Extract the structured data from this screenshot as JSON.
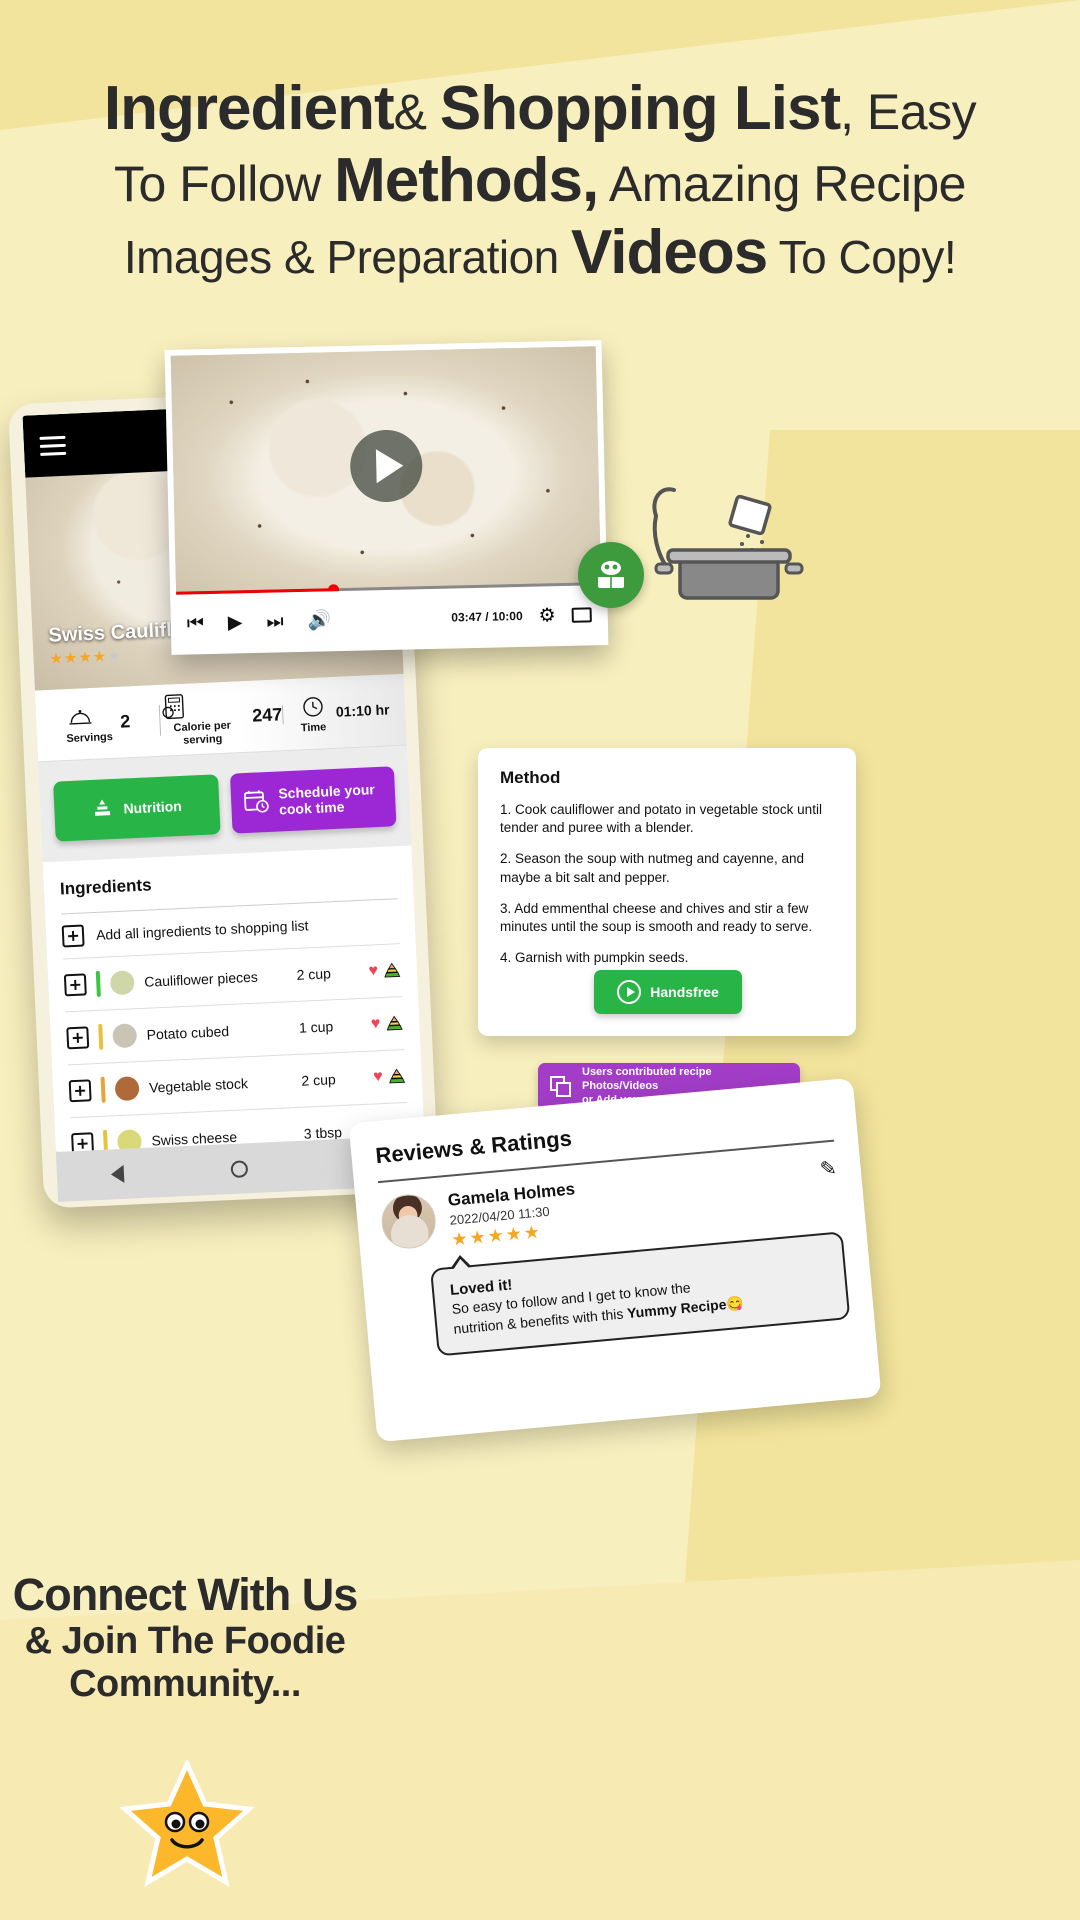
{
  "headline": {
    "line1_a": "Ingredient",
    "line1_b": "& ",
    "line1_c": "Shopping List",
    "line1_d": ", Easy",
    "line2_a": "To Follow ",
    "line2_b": "Methods,",
    "line2_c": " Amazing Recipe",
    "line3_a": "Images & Preparation ",
    "line3_b": "Videos",
    "line3_c": " To Copy!"
  },
  "phone": {
    "hero_title": "Swiss Cauliflower Soup",
    "hero_rating_filled": "★★★★",
    "hero_rating_empty": "★",
    "menu_icon": "hamburger-icon",
    "stats": [
      {
        "icon": "serving-dome-icon",
        "label": "Servings",
        "value": "2"
      },
      {
        "icon": "calorie-calculator-icon",
        "label": "Calorie per serving",
        "value": "247"
      },
      {
        "icon": "clock-icon",
        "label": "Time",
        "value": "01:10 hr"
      }
    ],
    "nutrition_button": "Nutrition",
    "schedule_button_line1": "Schedule your",
    "schedule_button_line2": "cook time",
    "ingredients_title": "Ingredients",
    "add_all_label": "Add all ingredients to shopping list",
    "ingredients": [
      {
        "name": "Cauliflower pieces",
        "qty": "2 cup",
        "bar": "#3ec43e",
        "thumb": "#cfd6a8"
      },
      {
        "name": "Potato cubed",
        "qty": "1 cup",
        "bar": "#e8c23a",
        "thumb": "#c9c4b6"
      },
      {
        "name": "Vegetable stock",
        "qty": "2 cup",
        "bar": "#e8a33a",
        "thumb": "#b06a3a"
      },
      {
        "name": "Swiss cheese",
        "qty": "3 tbsp",
        "bar": "#e8c23a",
        "thumb": "#d9d97a"
      }
    ],
    "nav": [
      "back-triangle-icon",
      "home-circle-icon",
      "recents-square-icon"
    ]
  },
  "video": {
    "time_display": "03:47 / 10:00",
    "progress_percent": 37,
    "controls": [
      "previous-icon",
      "play-icon",
      "next-icon",
      "volume-icon"
    ],
    "settings_icon": "gear-icon",
    "fullscreen_icon": "fullscreen-icon",
    "play_overlay_icon": "play-overlay-icon"
  },
  "method": {
    "title": "Method",
    "steps": [
      "1. Cook cauliflower and potato in vegetable stock until tender and puree with a blender.",
      "2. Season the soup with nutmeg and cayenne, and maybe a bit salt and pepper.",
      "3. Add emmenthal cheese and chives and stir a few minutes until the soup is smooth and ready to serve.",
      "4. Garnish with pumpkin seeds."
    ],
    "handsfree_button": "Handsfree"
  },
  "contributed": {
    "line1": "Users contributed recipe Photos/Videos",
    "line2": "or Add your own",
    "icon": "copy-photos-icon"
  },
  "reviews": {
    "title": "Reviews & Ratings",
    "reviewer_name": "Gamela Holmes",
    "date": "2022/04/20 11:30",
    "stars": "★★★★★",
    "edit_icon": "pencil-edit-icon",
    "bubble_headline": "Loved it!",
    "bubble_line1": "So easy to follow and I get to know the",
    "bubble_line2_a": "nutrition & benefits with this ",
    "bubble_line2_b": "Yummy Recipe",
    "bubble_emoji": "😋"
  },
  "bottom": {
    "line1": "Connect With Us",
    "line2": "& Join The Foodie",
    "line3": "Community..."
  },
  "colors": {
    "background": "#f8efbe",
    "background_alt": "#f2e49c",
    "green": "#28b446",
    "purple": "#9c27d4",
    "purple_light": "#a33dc8",
    "red": "#ef0000",
    "star": "#f5a623",
    "text": "#2b2b2b"
  }
}
